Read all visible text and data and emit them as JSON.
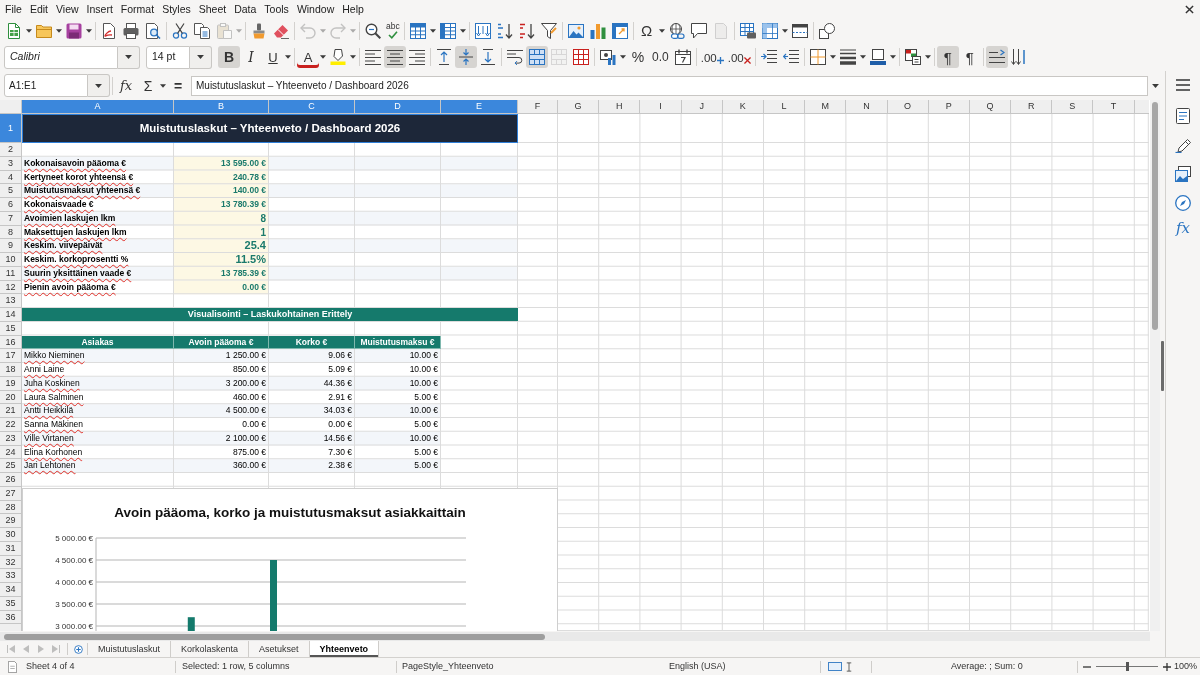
{
  "menu_bar": [
    "File",
    "Edit",
    "View",
    "Insert",
    "Format",
    "Styles",
    "Sheet",
    "Data",
    "Tools",
    "Window",
    "Help"
  ],
  "standard_toolbar": {
    "paste_disabled": true,
    "undo_disabled": true,
    "redo_disabled": true,
    "spelling_label": "abc",
    "special_character_label": "Ω",
    "headers_footers_disabled": true
  },
  "formatting_toolbar": {
    "font_name": "Calibri",
    "font_size": "14 pt",
    "bold": {
      "label": "B",
      "on": true
    },
    "italic": {
      "label": "I",
      "on": false
    },
    "underline": {
      "label": "U",
      "on": false
    },
    "font_color_label": "A",
    "align_left_on": false,
    "align_center_on": true,
    "align_right_on": false,
    "align_top_on": false,
    "align_middle_on": true,
    "align_bottom_on": false,
    "merge_and_center_on": true,
    "merge_cells_disabled": true,
    "percent_label": "%",
    "standard_format_label": "0.0",
    "add_decimal_label": ".00",
    "delete_decimal_label": ".00",
    "left_to_right": {
      "label": "¶",
      "on": true
    },
    "right_to_left": {
      "label": "¶",
      "on": false
    },
    "text_left_to_right_on": true,
    "text_top_to_bottom_on": false
  },
  "formula_bar": {
    "name_box": "A1:E1",
    "function_wizard_label": "fx",
    "sum_label": "Σ",
    "equals_label": "=",
    "content": "Muistutuslaskut – Yhteenveto / Dashboard 2026"
  },
  "sidebar": {
    "functions_label": "fx"
  },
  "sheet": {
    "columns": [
      {
        "letter": "A",
        "selected": true
      },
      {
        "letter": "B",
        "selected": true
      },
      {
        "letter": "C",
        "selected": true
      },
      {
        "letter": "D",
        "selected": true
      },
      {
        "letter": "E",
        "selected": true
      },
      {
        "letter": "F",
        "selected": false
      },
      {
        "letter": "G",
        "selected": false
      },
      {
        "letter": "H",
        "selected": false
      },
      {
        "letter": "I",
        "selected": false
      },
      {
        "letter": "J",
        "selected": false
      },
      {
        "letter": "K",
        "selected": false
      },
      {
        "letter": "L",
        "selected": false
      },
      {
        "letter": "M",
        "selected": false
      },
      {
        "letter": "N",
        "selected": false
      },
      {
        "letter": "O",
        "selected": false
      },
      {
        "letter": "P",
        "selected": false
      },
      {
        "letter": "Q",
        "selected": false
      },
      {
        "letter": "R",
        "selected": false
      },
      {
        "letter": "S",
        "selected": false
      },
      {
        "letter": "T",
        "selected": false
      }
    ],
    "rows": [
      {
        "number": "1",
        "selected": true
      },
      {
        "number": "2",
        "selected": false
      },
      {
        "number": "3",
        "selected": false
      },
      {
        "number": "4",
        "selected": false
      },
      {
        "number": "5",
        "selected": false
      },
      {
        "number": "6",
        "selected": false
      },
      {
        "number": "7",
        "selected": false
      },
      {
        "number": "8",
        "selected": false
      },
      {
        "number": "9",
        "selected": false
      },
      {
        "number": "10",
        "selected": false
      },
      {
        "number": "11",
        "selected": false
      },
      {
        "number": "12",
        "selected": false
      },
      {
        "number": "13",
        "selected": false
      },
      {
        "number": "14",
        "selected": false
      },
      {
        "number": "15",
        "selected": false
      },
      {
        "number": "16",
        "selected": false
      },
      {
        "number": "17",
        "selected": false
      },
      {
        "number": "18",
        "selected": false
      },
      {
        "number": "19",
        "selected": false
      },
      {
        "number": "20",
        "selected": false
      },
      {
        "number": "21",
        "selected": false
      },
      {
        "number": "22",
        "selected": false
      },
      {
        "number": "23",
        "selected": false
      },
      {
        "number": "24",
        "selected": false
      },
      {
        "number": "25",
        "selected": false
      },
      {
        "number": "26",
        "selected": false
      },
      {
        "number": "27",
        "selected": false
      },
      {
        "number": "28",
        "selected": false
      },
      {
        "number": "29",
        "selected": false
      },
      {
        "number": "30",
        "selected": false
      },
      {
        "number": "31",
        "selected": false
      },
      {
        "number": "32",
        "selected": false
      },
      {
        "number": "33",
        "selected": false
      },
      {
        "number": "34",
        "selected": false
      },
      {
        "number": "35",
        "selected": false
      },
      {
        "number": "36",
        "selected": false
      }
    ],
    "title": "Muistutuslaskut – Yhteenveto / Dashboard 2026",
    "summary": [
      {
        "label": "Kokonaisavoin pääoma €",
        "value": "13 595.00 €",
        "kind": "currency"
      },
      {
        "label": "Kertyneet korot yhteensä €",
        "value": "240.78 €",
        "kind": "currency"
      },
      {
        "label": "Muistutusmaksut yhteensä €",
        "value": "140.00 €",
        "kind": "currency"
      },
      {
        "label": "Kokonaisvaade €",
        "value": "13 780.39 €",
        "kind": "currency"
      },
      {
        "label": "Avoimien laskujen lkm",
        "value": "8",
        "kind": "count"
      },
      {
        "label": "Maksettujen laskujen lkm",
        "value": "1",
        "kind": "count"
      },
      {
        "label": "Keskim. viivepäivät",
        "value": "25.4",
        "kind": "decimal"
      },
      {
        "label": "Keskim. korkoprosentti %",
        "value": "11.5%",
        "kind": "decimal"
      },
      {
        "label": "Suurin yksittäinen vaade €",
        "value": "13 785.39 €",
        "kind": "currency"
      },
      {
        "label": "Pienin avoin pääoma €",
        "value": "0.00 €",
        "kind": "currency"
      }
    ],
    "section_title": "Visualisointi – Laskukohtainen Erittely",
    "table": {
      "columns": [
        "Asiakas",
        "Avoin pääoma €",
        "Korko €",
        "Muistutusmaksu €"
      ],
      "rows": [
        [
          "Mikko Nieminen",
          "1 250.00 €",
          "9.06 €",
          "10.00 €"
        ],
        [
          "Anni Laine",
          "850.00 €",
          "5.09 €",
          "10.00 €"
        ],
        [
          "Juha Koskinen",
          "3 200.00 €",
          "44.36 €",
          "10.00 €"
        ],
        [
          "Laura Salminen",
          "460.00 €",
          "2.91 €",
          "5.00 €"
        ],
        [
          "Antti Heikkilä",
          "4 500.00 €",
          "34.03 €",
          "10.00 €"
        ],
        [
          "Sanna Mäkinen",
          "0.00 €",
          "0.00 €",
          "5.00 €"
        ],
        [
          "Ville Virtanen",
          "2 100.00 €",
          "14.56 €",
          "10.00 €"
        ],
        [
          "Elina Korhonen",
          "875.00 €",
          "7.30 €",
          "5.00 €"
        ],
        [
          "Jari Lehtonen",
          "360.00 €",
          "2.38 €",
          "5.00 €"
        ]
      ]
    },
    "chart": {
      "chart_data": {
        "type": "bar",
        "title": "Avoin pääoma, korko ja muistutusmaksut asiakkaittain",
        "ylim": [
          2880,
          5000
        ],
        "yticks": [
          {
            "value": 3000,
            "label": "3 000.00 €"
          },
          {
            "value": 3500,
            "label": "3 500.00 €"
          },
          {
            "value": 4000,
            "label": "4 000.00 €"
          },
          {
            "value": 4500,
            "label": "4 500.00 €"
          },
          {
            "value": 5000,
            "label": "5 000.00 €"
          }
        ],
        "grid": true,
        "series": [
          {
            "color": "#147a6c",
            "values": [
              null,
              null,
              3200,
              null,
              4500,
              null,
              null,
              null,
              null
            ]
          }
        ]
      }
    }
  },
  "sheet_tabs": {
    "navigation_disabled": true,
    "tabs": [
      {
        "label": "Muistutuslaskut",
        "selected": false
      },
      {
        "label": "Korkolaskenta",
        "selected": false
      },
      {
        "label": "Asetukset",
        "selected": false
      },
      {
        "label": "Yhteenveto",
        "selected": true
      }
    ]
  },
  "status_bar": {
    "sheet_position": "Sheet 4 of 4",
    "selection": "Selected: 1 row, 5 columns",
    "page_style": "PageStyle_Yhteenveto",
    "language": "English (USA)",
    "statistics": "Average: ; Sum: 0",
    "zoom": {
      "level": 0.5,
      "label": "100%"
    }
  }
}
